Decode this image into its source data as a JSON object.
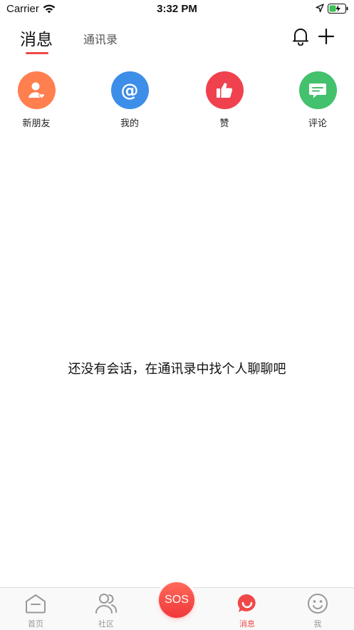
{
  "status_bar": {
    "carrier": "Carrier",
    "time": "3:32 PM"
  },
  "header": {
    "tab_messages": "消息",
    "tab_contacts": "通讯录",
    "accent_color": "#f04848"
  },
  "quick_actions": [
    {
      "label": "新朋友",
      "color": "#ff7f4f",
      "icon": "add-friend-icon"
    },
    {
      "label": "我的",
      "color": "#3d8ee8",
      "icon": "at-icon"
    },
    {
      "label": "赞",
      "color": "#f0414f",
      "icon": "thumbs-up-icon"
    },
    {
      "label": "评论",
      "color": "#43c16d",
      "icon": "comment-icon"
    }
  ],
  "empty_state": {
    "text": "还没有会话，在通讯录中找个人聊聊吧"
  },
  "tabbar": {
    "items": [
      {
        "label": "首页",
        "icon": "home-icon"
      },
      {
        "label": "社区",
        "icon": "community-icon"
      },
      {
        "label": "SOS",
        "icon": "sos-button"
      },
      {
        "label": "消息",
        "icon": "message-icon",
        "active": true
      },
      {
        "label": "我",
        "icon": "smile-icon"
      }
    ]
  }
}
